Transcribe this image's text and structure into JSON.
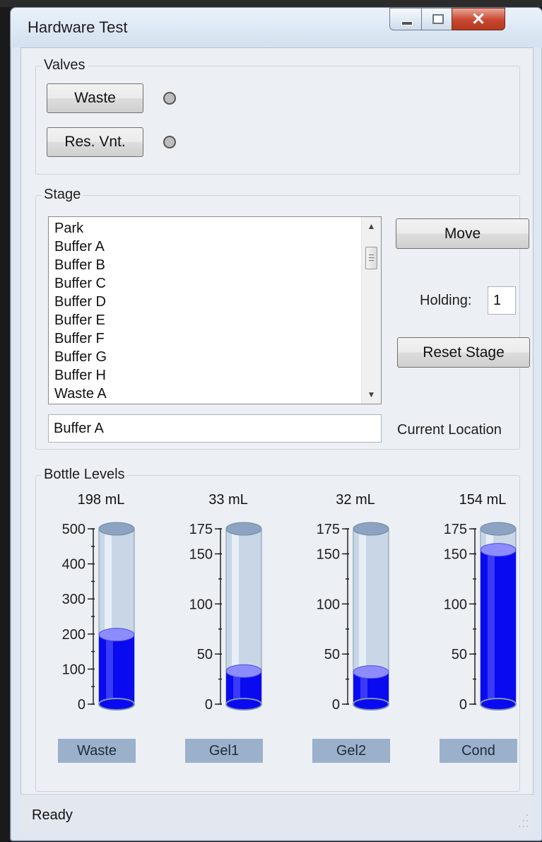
{
  "window": {
    "title": "Hardware Test"
  },
  "valves": {
    "title": "Valves",
    "items": [
      {
        "label": "Waste",
        "state": "off"
      },
      {
        "label": "Res. Vnt.",
        "state": "off"
      }
    ]
  },
  "stage": {
    "title": "Stage",
    "list": [
      "Park",
      "Buffer A",
      "Buffer B",
      "Buffer C",
      "Buffer D",
      "Buffer E",
      "Buffer F",
      "Buffer G",
      "Buffer H",
      "Waste A"
    ],
    "move_label": "Move",
    "holding_label": "Holding:",
    "holding_value": "1",
    "reset_label": "Reset Stage",
    "current_location_value": "Buffer A",
    "current_location_label": "Current Location"
  },
  "bottles": {
    "title": "Bottle Levels",
    "gauges": [
      {
        "name": "Waste",
        "value_text": "198 mL",
        "value": 198,
        "max": 500,
        "ticks": [
          "500",
          "400",
          "300",
          "200",
          "100",
          "0"
        ],
        "tick_values": [
          500,
          400,
          300,
          200,
          100,
          0
        ]
      },
      {
        "name": "Gel1",
        "value_text": "33 mL",
        "value": 33,
        "max": 175,
        "ticks": [
          "175",
          "150",
          "100",
          "50",
          "0"
        ],
        "tick_values": [
          175,
          150,
          100,
          50,
          0
        ]
      },
      {
        "name": "Gel2",
        "value_text": "32 mL",
        "value": 32,
        "max": 175,
        "ticks": [
          "175",
          "150",
          "100",
          "50",
          "0"
        ],
        "tick_values": [
          175,
          150,
          100,
          50,
          0
        ]
      },
      {
        "name": "Cond",
        "value_text": "154 mL",
        "value": 154,
        "max": 175,
        "ticks": [
          "175",
          "150",
          "100",
          "50",
          "0"
        ],
        "tick_values": [
          175,
          150,
          100,
          50,
          0
        ]
      }
    ]
  },
  "statusbar": {
    "text": "Ready"
  },
  "colors": {
    "liquid": "#0a0af0",
    "tube": "#c9d6e6",
    "label_bg": "#9bb1cb",
    "close": "#c9462e"
  },
  "icons": [
    "minimize-icon",
    "maximize-icon",
    "close-icon",
    "scroll-up-icon",
    "scroll-down-icon",
    "resize-grip-icon"
  ]
}
